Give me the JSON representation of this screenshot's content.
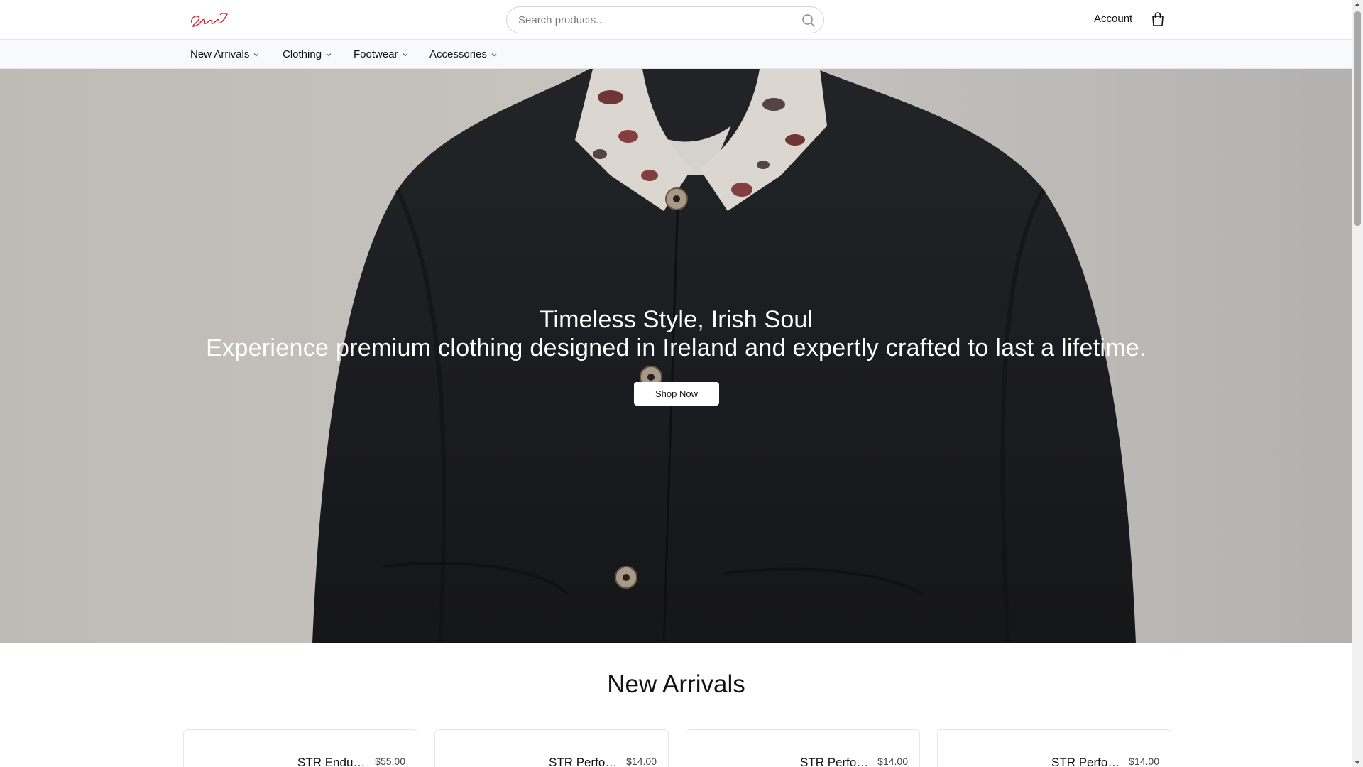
{
  "brand": {
    "logo_icon": "script-logo-icon"
  },
  "search": {
    "placeholder": "Search products...",
    "icon": "search-icon"
  },
  "header": {
    "account_label": "Account",
    "cart_icon": "shopping-bag-icon"
  },
  "nav": {
    "items": [
      {
        "label": "New Arrivals"
      },
      {
        "label": "Clothing"
      },
      {
        "label": "Footwear"
      },
      {
        "label": "Accessories"
      }
    ]
  },
  "hero": {
    "title": "Timeless Style, Irish Soul",
    "subtitle": "Experience premium clothing designed in Ireland and expertly crafted to last a lifetime.",
    "cta_label": "Shop Now"
  },
  "new_arrivals": {
    "title": "New Arrivals",
    "products": [
      {
        "name": "STR Endurance",
        "price": "$55.00"
      },
      {
        "name": "STR Performance",
        "price": "$14.00"
      },
      {
        "name": "STR Performance",
        "price": "$14.00"
      },
      {
        "name": "STR Performance",
        "price": "$14.00"
      }
    ]
  },
  "colors": {
    "accent_logo": "#c0202c",
    "hero_jacket": "#1c1d20",
    "hero_bg": "#d6d3ce"
  }
}
